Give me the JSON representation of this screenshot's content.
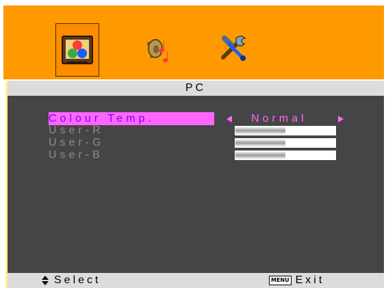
{
  "app": {
    "title": "PC"
  },
  "top_tabs": [
    {
      "name": "picture",
      "selected": true,
      "icon": "picture-settings-icon"
    },
    {
      "name": "audio",
      "selected": false,
      "icon": "speaker-music-icon"
    },
    {
      "name": "setup",
      "selected": false,
      "icon": "tools-icon"
    }
  ],
  "menu": {
    "colour_temp_label": "Colour Temp.",
    "colour_temp_value": "Normal",
    "user_r_label": "User-R",
    "user_g_label": "User-G",
    "user_b_label": "User-B",
    "user_r_level": 0.5,
    "user_g_level": 0.5,
    "user_b_level": 0.5
  },
  "footer": {
    "select_label": "Select",
    "menu_key_label": "MENU",
    "exit_label": "Exit"
  },
  "colors": {
    "top_bar": "#ff9900",
    "content_bg": "#454545",
    "highlight_bg": "#ff66ff",
    "highlight_text": "#7f00ff",
    "value_text": "#ff66ff"
  }
}
